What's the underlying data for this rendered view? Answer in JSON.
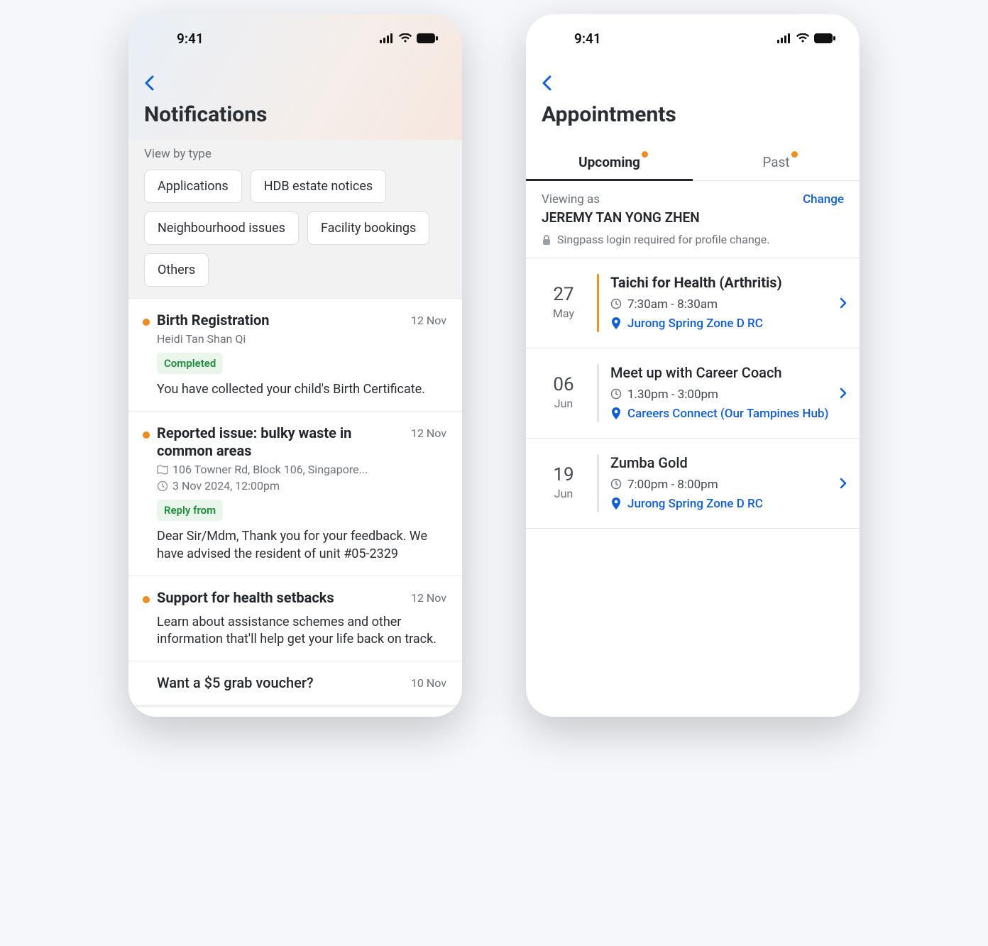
{
  "statusbar": {
    "time": "9:41"
  },
  "left": {
    "title": "Notifications",
    "filter_label": "View by type",
    "filters": [
      "Applications",
      "HDB estate notices",
      "Neighbourhood issues",
      "Facility bookings",
      "Others"
    ],
    "items": [
      {
        "title": "Birth Registration",
        "date": "12 Nov",
        "subtitle": "Heidi Tan Shan Qi",
        "badge": "Completed",
        "body": "You have collected your child's Birth Certificate.",
        "unread": true
      },
      {
        "title": "Reported issue: bulky waste in common areas",
        "date": "12 Nov",
        "location": "106 Towner Rd, Block 106, Singapore...",
        "timestamp": "3 Nov 2024, 12:00pm",
        "badge": "Reply from",
        "body": "Dear Sir/Mdm, Thank you for your feedback. We have advised the resident of unit #05-2329",
        "unread": true
      },
      {
        "title": "Support for health setbacks",
        "date": "12 Nov",
        "body": "Learn about assistance schemes and other information that'll help get your life back on track.",
        "unread": true
      },
      {
        "title": "Want a $5 grab voucher?",
        "date": "10 Nov",
        "unread": false
      }
    ]
  },
  "right": {
    "title": "Appointments",
    "tabs": {
      "upcoming": "Upcoming",
      "past": "Past"
    },
    "viewing": {
      "label": "Viewing as",
      "name": "JEREMY TAN YONG ZHEN",
      "change": "Change",
      "note": "Singpass login required for profile change."
    },
    "appointments": [
      {
        "day": "27",
        "month": "May",
        "title": "Taichi for Health (Arthritis)",
        "time": "7:30am - 8:30am",
        "location": "Jurong Spring Zone D RC",
        "highlight": true
      },
      {
        "day": "06",
        "month": "Jun",
        "title": "Meet up with Career Coach",
        "time": "1.30pm - 3:00pm",
        "location": "Careers Connect (Our Tampines Hub)",
        "highlight": false
      },
      {
        "day": "19",
        "month": "Jun",
        "title": "Zumba Gold",
        "time": "7:00pm - 8:00pm",
        "location": "Jurong Spring Zone D RC",
        "highlight": false
      }
    ]
  }
}
